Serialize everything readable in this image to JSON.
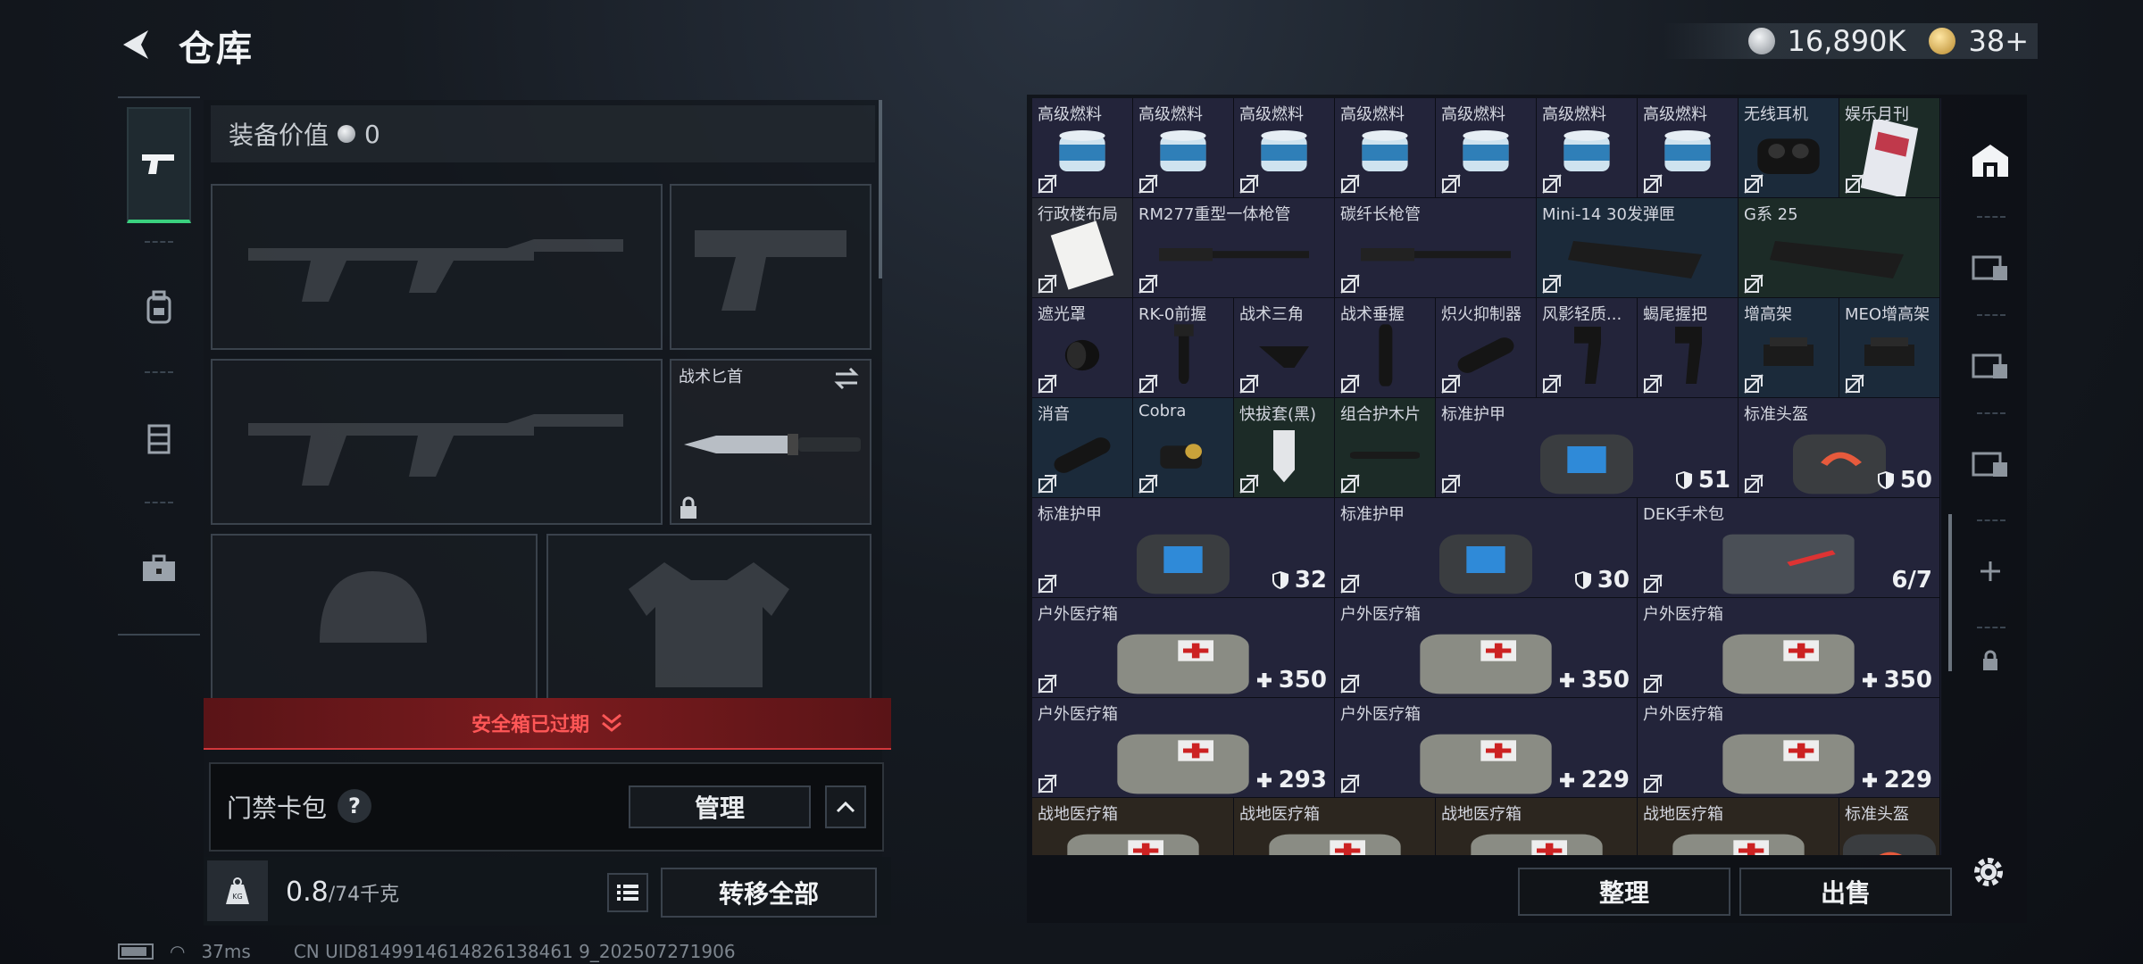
{
  "header": {
    "title": "仓库"
  },
  "currency": {
    "silver": "16,890K",
    "gold": "38+"
  },
  "equipment": {
    "value_label": "装备价值",
    "value": "0",
    "knife_label": "战术匕首"
  },
  "safebox": {
    "label": "安全箱已过期"
  },
  "keycard": {
    "label": "门禁卡包",
    "help": "?",
    "manage": "管理"
  },
  "weight": {
    "current": "0.8",
    "max": "/74千克",
    "transfer_all": "转移全部"
  },
  "stash": {
    "items": [
      {
        "name": "高级燃料",
        "rarity": "purple",
        "icon": "fuel-can-icon"
      },
      {
        "name": "高级燃料",
        "rarity": "purple",
        "icon": "fuel-can-icon"
      },
      {
        "name": "高级燃料",
        "rarity": "purple",
        "icon": "fuel-can-icon"
      },
      {
        "name": "高级燃料",
        "rarity": "purple",
        "icon": "fuel-can-icon"
      },
      {
        "name": "高级燃料",
        "rarity": "purple",
        "icon": "fuel-can-icon"
      },
      {
        "name": "高级燃料",
        "rarity": "purple",
        "icon": "fuel-can-icon"
      },
      {
        "name": "高级燃料",
        "rarity": "purple",
        "icon": "fuel-can-icon"
      },
      {
        "name": "无线耳机",
        "rarity": "blue",
        "icon": "earbuds-icon"
      },
      {
        "name": "娱乐月刊",
        "rarity": "green",
        "icon": "magazine-icon"
      },
      {
        "name": "行政楼布局",
        "rarity": "grey",
        "icon": "paper-icon"
      },
      {
        "name": "RM277重型一体枪管",
        "rarity": "purple",
        "icon": "barrel-icon"
      },
      {
        "name": "碳纤长枪管",
        "rarity": "purple",
        "icon": "barrel-icon"
      },
      {
        "name": "Mini-14 30发弹匣",
        "rarity": "blue",
        "icon": "magazine-clip-icon"
      },
      {
        "name": "G系 25",
        "rarity": "green",
        "icon": "magazine-clip-icon"
      },
      {
        "name": "遮光罩",
        "rarity": "purple",
        "icon": "scope-shade-icon"
      },
      {
        "name": "RK-0前握",
        "rarity": "purple",
        "icon": "foregrip-icon"
      },
      {
        "name": "战术三角",
        "rarity": "purple",
        "icon": "angled-grip-icon"
      },
      {
        "name": "战术垂握",
        "rarity": "purple",
        "icon": "vertical-grip-icon"
      },
      {
        "name": "炽火抑制器",
        "rarity": "purple",
        "icon": "suppressor-icon"
      },
      {
        "name": "风影轻质...",
        "rarity": "purple",
        "icon": "pistol-grip-icon"
      },
      {
        "name": "蝎尾握把",
        "rarity": "purple",
        "icon": "pistol-grip-icon"
      },
      {
        "name": "增高架",
        "rarity": "blue",
        "icon": "riser-icon"
      },
      {
        "name": "MEO增高架",
        "rarity": "blue",
        "icon": "riser-icon"
      },
      {
        "name": "消音",
        "rarity": "blue",
        "icon": "suppressor-icon"
      },
      {
        "name": "Cobra",
        "rarity": "blue",
        "icon": "red-dot-icon"
      },
      {
        "name": "快拔套(黑)",
        "rarity": "green",
        "icon": "holster-icon"
      },
      {
        "name": "组合护木片",
        "rarity": "green",
        "icon": "rail-cover-icon"
      },
      {
        "name": "标准护甲",
        "rarity": "purple",
        "icon": "armor-icon",
        "stat": "51"
      },
      {
        "name": "标准头盔",
        "rarity": "purple",
        "icon": "helmet-icon",
        "stat": "50"
      },
      {
        "name": "标准护甲",
        "rarity": "purple",
        "icon": "armor-icon",
        "stat": "32"
      },
      {
        "name": "标准护甲",
        "rarity": "purple",
        "icon": "armor-icon",
        "stat": "30"
      },
      {
        "name": "DEK手术包",
        "rarity": "purple",
        "icon": "surgery-kit-icon",
        "stat": "6/7"
      },
      {
        "name": "户外医疗箱",
        "rarity": "purple",
        "icon": "medkit-icon",
        "stat": "350"
      },
      {
        "name": "户外医疗箱",
        "rarity": "purple",
        "icon": "medkit-icon",
        "stat": "350"
      },
      {
        "name": "户外医疗箱",
        "rarity": "purple",
        "icon": "medkit-icon",
        "stat": "350"
      },
      {
        "name": "户外医疗箱",
        "rarity": "purple",
        "icon": "medkit-icon",
        "stat": "293"
      },
      {
        "name": "户外医疗箱",
        "rarity": "purple",
        "icon": "medkit-icon",
        "stat": "229"
      },
      {
        "name": "户外医疗箱",
        "rarity": "purple",
        "icon": "medkit-icon",
        "stat": "229"
      },
      {
        "name": "战地医疗箱",
        "rarity": "brown",
        "icon": "medkit-icon"
      },
      {
        "name": "战地医疗箱",
        "rarity": "brown",
        "icon": "medkit-icon"
      },
      {
        "name": "战地医疗箱",
        "rarity": "brown",
        "icon": "medkit-icon"
      },
      {
        "name": "战地医疗箱",
        "rarity": "brown",
        "icon": "medkit-icon"
      },
      {
        "name": "标准头盔",
        "rarity": "brown",
        "icon": "helmet-icon"
      }
    ],
    "sort": "整理",
    "sell": "出售"
  },
  "status": {
    "ping": "37ms",
    "uid": "CN UID8149914614826138461 9_202507271906"
  },
  "colors": {
    "accent_green": "#3ad17f",
    "warning_red": "#ff5757",
    "rarity_purple": "#23243a",
    "rarity_blue": "#1b2a3a",
    "rarity_green": "#1c2b27"
  }
}
